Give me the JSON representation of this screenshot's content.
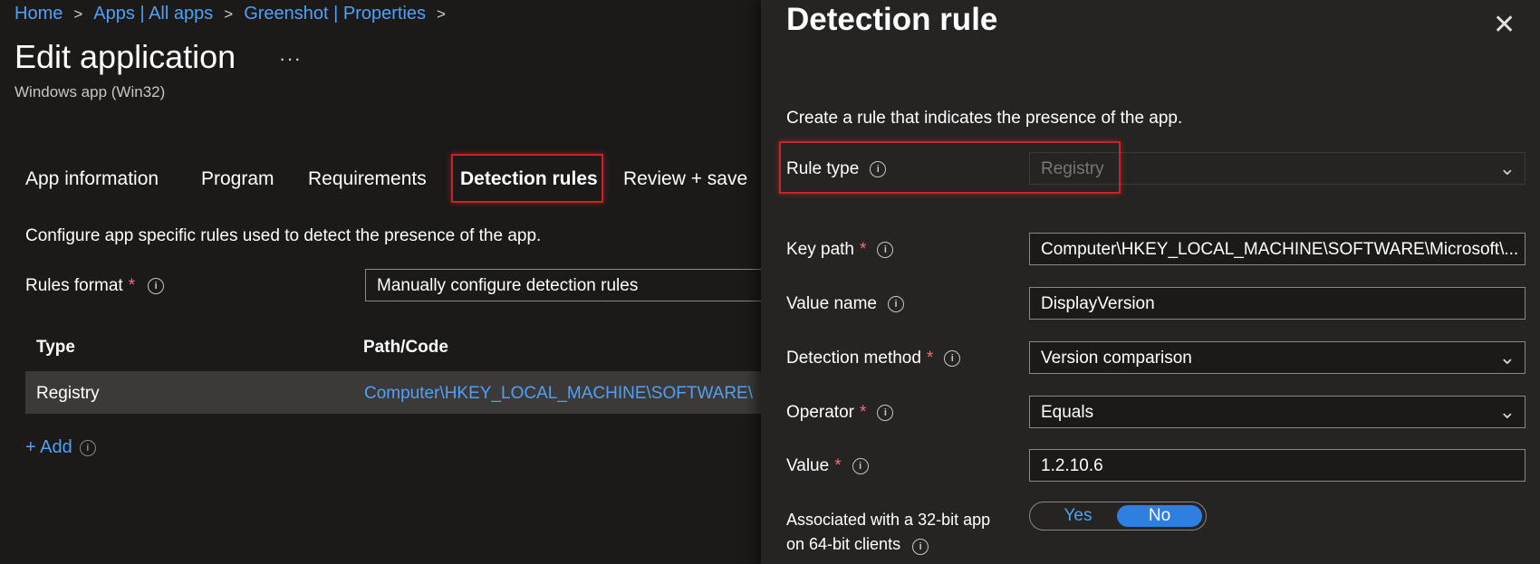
{
  "breadcrumb": {
    "items": [
      "Home",
      "Apps | All apps",
      "Greenshot | Properties"
    ],
    "separator": ">"
  },
  "header": {
    "title": "Edit application",
    "more": "···",
    "subtitle": "Windows app (Win32)"
  },
  "tabs": [
    {
      "label": "App information",
      "active": false
    },
    {
      "label": "Program",
      "active": false
    },
    {
      "label": "Requirements",
      "active": false
    },
    {
      "label": "Detection rules",
      "active": true
    },
    {
      "label": "Review + save",
      "active": false
    }
  ],
  "detection": {
    "description": "Configure app specific rules used to detect the presence of the app.",
    "rules_format_label": "Rules format",
    "required_mark": "*",
    "rules_format_value": "Manually configure detection rules",
    "table": {
      "headers": [
        "Type",
        "Path/Code"
      ],
      "rows": [
        {
          "type": "Registry",
          "path": "Computer\\HKEY_LOCAL_MACHINE\\SOFTWARE\\Microsoft\\Windows\\CurrentVersion\\Uninstall"
        }
      ]
    },
    "add_label": "+ Add"
  },
  "panel": {
    "title": "Detection rule",
    "close": "✕",
    "description": "Create a rule that indicates the presence of the app.",
    "rule_type": {
      "label": "Rule type",
      "value": "Registry"
    },
    "key_path": {
      "label": "Key path",
      "value": "Computer\\HKEY_LOCAL_MACHINE\\SOFTWARE\\Microsoft\\..."
    },
    "value_name": {
      "label": "Value name",
      "value": "DisplayVersion"
    },
    "detection_method": {
      "label": "Detection method",
      "value": "Version comparison"
    },
    "operator": {
      "label": "Operator",
      "value": "Equals"
    },
    "value": {
      "label": "Value",
      "value": "1.2.10.6"
    },
    "assoc": {
      "line1": "Associated with a 32-bit app",
      "line2": "on 64-bit clients",
      "yes": "Yes",
      "no": "No",
      "selected": "No"
    }
  },
  "colors": {
    "background": "#1b1a19",
    "panel": "#252423",
    "link": "#4ea1f7",
    "highlight": "#c4252b",
    "toggle_active": "#2f7fe0"
  }
}
